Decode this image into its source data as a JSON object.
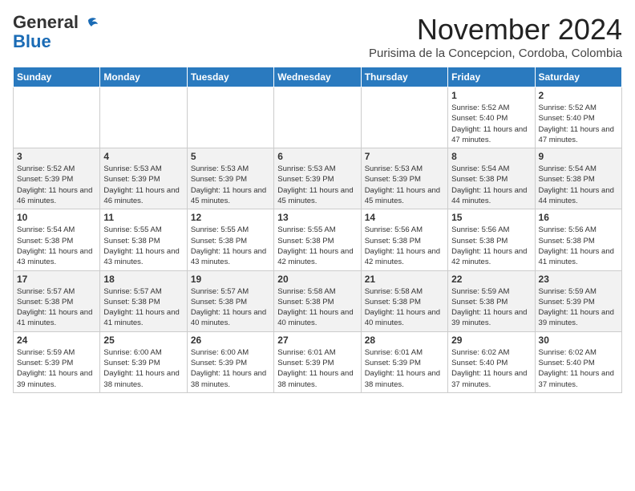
{
  "header": {
    "logo_general": "General",
    "logo_blue": "Blue",
    "month_title": "November 2024",
    "subtitle": "Purisima de la Concepcion, Cordoba, Colombia"
  },
  "weekdays": [
    "Sunday",
    "Monday",
    "Tuesday",
    "Wednesday",
    "Thursday",
    "Friday",
    "Saturday"
  ],
  "weeks": [
    [
      {
        "day": "",
        "info": ""
      },
      {
        "day": "",
        "info": ""
      },
      {
        "day": "",
        "info": ""
      },
      {
        "day": "",
        "info": ""
      },
      {
        "day": "",
        "info": ""
      },
      {
        "day": "1",
        "info": "Sunrise: 5:52 AM\nSunset: 5:40 PM\nDaylight: 11 hours and 47 minutes."
      },
      {
        "day": "2",
        "info": "Sunrise: 5:52 AM\nSunset: 5:40 PM\nDaylight: 11 hours and 47 minutes."
      }
    ],
    [
      {
        "day": "3",
        "info": "Sunrise: 5:52 AM\nSunset: 5:39 PM\nDaylight: 11 hours and 46 minutes."
      },
      {
        "day": "4",
        "info": "Sunrise: 5:53 AM\nSunset: 5:39 PM\nDaylight: 11 hours and 46 minutes."
      },
      {
        "day": "5",
        "info": "Sunrise: 5:53 AM\nSunset: 5:39 PM\nDaylight: 11 hours and 45 minutes."
      },
      {
        "day": "6",
        "info": "Sunrise: 5:53 AM\nSunset: 5:39 PM\nDaylight: 11 hours and 45 minutes."
      },
      {
        "day": "7",
        "info": "Sunrise: 5:53 AM\nSunset: 5:39 PM\nDaylight: 11 hours and 45 minutes."
      },
      {
        "day": "8",
        "info": "Sunrise: 5:54 AM\nSunset: 5:38 PM\nDaylight: 11 hours and 44 minutes."
      },
      {
        "day": "9",
        "info": "Sunrise: 5:54 AM\nSunset: 5:38 PM\nDaylight: 11 hours and 44 minutes."
      }
    ],
    [
      {
        "day": "10",
        "info": "Sunrise: 5:54 AM\nSunset: 5:38 PM\nDaylight: 11 hours and 43 minutes."
      },
      {
        "day": "11",
        "info": "Sunrise: 5:55 AM\nSunset: 5:38 PM\nDaylight: 11 hours and 43 minutes."
      },
      {
        "day": "12",
        "info": "Sunrise: 5:55 AM\nSunset: 5:38 PM\nDaylight: 11 hours and 43 minutes."
      },
      {
        "day": "13",
        "info": "Sunrise: 5:55 AM\nSunset: 5:38 PM\nDaylight: 11 hours and 42 minutes."
      },
      {
        "day": "14",
        "info": "Sunrise: 5:56 AM\nSunset: 5:38 PM\nDaylight: 11 hours and 42 minutes."
      },
      {
        "day": "15",
        "info": "Sunrise: 5:56 AM\nSunset: 5:38 PM\nDaylight: 11 hours and 42 minutes."
      },
      {
        "day": "16",
        "info": "Sunrise: 5:56 AM\nSunset: 5:38 PM\nDaylight: 11 hours and 41 minutes."
      }
    ],
    [
      {
        "day": "17",
        "info": "Sunrise: 5:57 AM\nSunset: 5:38 PM\nDaylight: 11 hours and 41 minutes."
      },
      {
        "day": "18",
        "info": "Sunrise: 5:57 AM\nSunset: 5:38 PM\nDaylight: 11 hours and 41 minutes."
      },
      {
        "day": "19",
        "info": "Sunrise: 5:57 AM\nSunset: 5:38 PM\nDaylight: 11 hours and 40 minutes."
      },
      {
        "day": "20",
        "info": "Sunrise: 5:58 AM\nSunset: 5:38 PM\nDaylight: 11 hours and 40 minutes."
      },
      {
        "day": "21",
        "info": "Sunrise: 5:58 AM\nSunset: 5:38 PM\nDaylight: 11 hours and 40 minutes."
      },
      {
        "day": "22",
        "info": "Sunrise: 5:59 AM\nSunset: 5:38 PM\nDaylight: 11 hours and 39 minutes."
      },
      {
        "day": "23",
        "info": "Sunrise: 5:59 AM\nSunset: 5:39 PM\nDaylight: 11 hours and 39 minutes."
      }
    ],
    [
      {
        "day": "24",
        "info": "Sunrise: 5:59 AM\nSunset: 5:39 PM\nDaylight: 11 hours and 39 minutes."
      },
      {
        "day": "25",
        "info": "Sunrise: 6:00 AM\nSunset: 5:39 PM\nDaylight: 11 hours and 38 minutes."
      },
      {
        "day": "26",
        "info": "Sunrise: 6:00 AM\nSunset: 5:39 PM\nDaylight: 11 hours and 38 minutes."
      },
      {
        "day": "27",
        "info": "Sunrise: 6:01 AM\nSunset: 5:39 PM\nDaylight: 11 hours and 38 minutes."
      },
      {
        "day": "28",
        "info": "Sunrise: 6:01 AM\nSunset: 5:39 PM\nDaylight: 11 hours and 38 minutes."
      },
      {
        "day": "29",
        "info": "Sunrise: 6:02 AM\nSunset: 5:40 PM\nDaylight: 11 hours and 37 minutes."
      },
      {
        "day": "30",
        "info": "Sunrise: 6:02 AM\nSunset: 5:40 PM\nDaylight: 11 hours and 37 minutes."
      }
    ]
  ]
}
